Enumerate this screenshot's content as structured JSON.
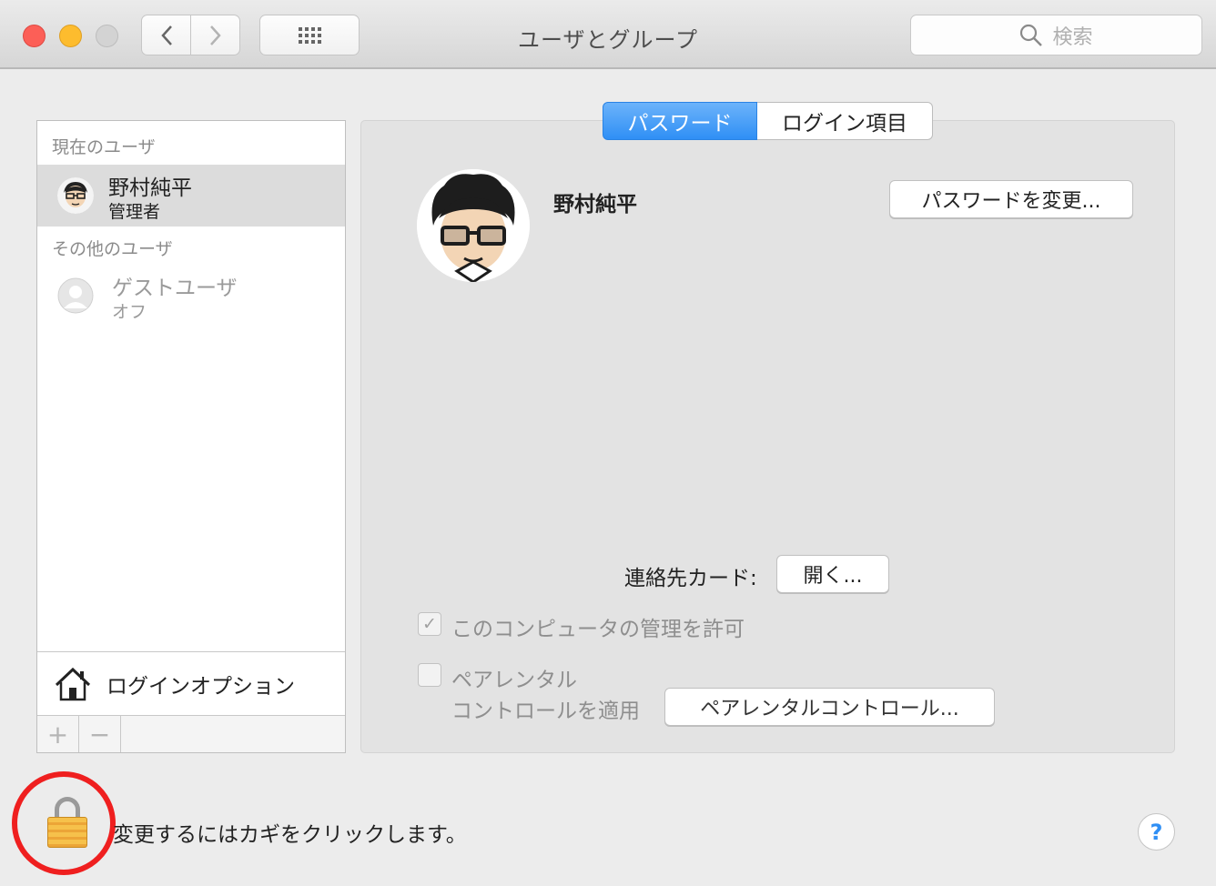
{
  "window": {
    "title": "ユーザとグループ",
    "search_placeholder": "検索"
  },
  "users": {
    "current_header": "現在のユーザ",
    "current_user": {
      "name": "野村純平",
      "role": "管理者"
    },
    "other_header": "その他のユーザ",
    "guest_user": {
      "name": "ゲストユーザ",
      "status": "オフ"
    },
    "login_options_label": "ログインオプション",
    "add_symbol": "+",
    "remove_symbol": "−"
  },
  "tabs": [
    {
      "label": "パスワード",
      "active": true
    },
    {
      "label": "ログイン項目",
      "active": false
    }
  ],
  "detail": {
    "user_name": "野村純平",
    "change_password_label": "パスワードを変更...",
    "contact_card_label": "連絡先カード:",
    "open_button_label": "開く...",
    "admin_checkbox": {
      "label": "このコンピュータの管理を許可",
      "checked": true,
      "enabled": false
    },
    "parental_checkbox": {
      "label_line1": "ペアレンタル",
      "label_line2": "コントロールを適用",
      "checked": false,
      "enabled": false
    },
    "parental_button_label": "ペアレンタルコントロール..."
  },
  "footer": {
    "lock_message": "変更するにはカギをクリックします。",
    "help_symbol": "?"
  },
  "colors": {
    "accent": "#2f8ff5",
    "annotation": "#ef1f1f",
    "close": "#fc5f57",
    "minimize": "#fdbc2e"
  },
  "icons": [
    "back-icon",
    "forward-icon",
    "grid-icon",
    "search-icon",
    "avatar",
    "guest-avatar-icon",
    "home-icon",
    "lock-icon",
    "help-icon"
  ]
}
